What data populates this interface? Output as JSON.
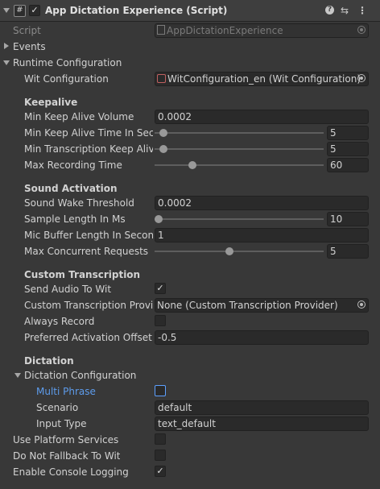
{
  "header": {
    "title": "App Dictation Experience (Script)",
    "enabled": true
  },
  "script": {
    "label": "Script",
    "value": "AppDictationExperience"
  },
  "events": {
    "label": "Events"
  },
  "runtime": {
    "label": "Runtime Configuration",
    "wit_config": {
      "label": "Wit Configuration",
      "value": "WitConfiguration_en (Wit Configuration)"
    },
    "keepalive": {
      "heading": "Keepalive",
      "min_keep_alive_volume": {
        "label": "Min Keep Alive Volume",
        "value": "0.0002"
      },
      "min_keep_alive_time": {
        "label": "Min Keep Alive Time In Seco",
        "value": "5",
        "fraction": 0.03
      },
      "min_transcription_keep_alive": {
        "label": "Min Transcription Keep Alive",
        "value": "5",
        "fraction": 0.03
      },
      "max_recording_time": {
        "label": "Max Recording Time",
        "value": "60",
        "fraction": 0.21
      }
    },
    "sound_activation": {
      "heading": "Sound Activation",
      "sound_wake_threshold": {
        "label": "Sound Wake Threshold",
        "value": "0.0002"
      },
      "sample_length": {
        "label": "Sample Length In Ms",
        "value": "10",
        "fraction": 0.0
      },
      "mic_buffer_length": {
        "label": "Mic Buffer Length In Second",
        "value": "1"
      },
      "max_concurrent_requests": {
        "label": "Max Concurrent Requests",
        "value": "5",
        "fraction": 0.44
      }
    },
    "custom_transcription": {
      "heading": "Custom Transcription",
      "send_audio_to_wit": {
        "label": "Send Audio To Wit",
        "checked": true
      },
      "provider": {
        "label": "Custom Transcription Provid",
        "value": "None (Custom Transcription Provider)"
      },
      "always_record": {
        "label": "Always Record",
        "checked": false
      },
      "preferred_activation_offset": {
        "label": "Preferred Activation Offset",
        "value": "-0.5"
      }
    },
    "dictation": {
      "heading": "Dictation",
      "config_label": "Dictation Configuration",
      "multi_phrase": {
        "label": "Multi Phrase",
        "checked": false
      },
      "scenario": {
        "label": "Scenario",
        "value": "default"
      },
      "input_type": {
        "label": "Input Type",
        "value": "text_default"
      }
    }
  },
  "use_platform_services": {
    "label": "Use Platform Services",
    "checked": false
  },
  "do_not_fallback": {
    "label": "Do Not Fallback To Wit",
    "checked": false
  },
  "enable_console_logging": {
    "label": "Enable Console Logging",
    "checked": true
  },
  "colors": {
    "background": "#383838",
    "field": "#2a2a2a",
    "accent_label": "#5d9cec",
    "text": "#d2d2d2"
  },
  "icons": [
    "chevron-down-icon",
    "script-icon",
    "help-icon",
    "presets-icon",
    "kebab-menu-icon",
    "object-picker-icon"
  ]
}
